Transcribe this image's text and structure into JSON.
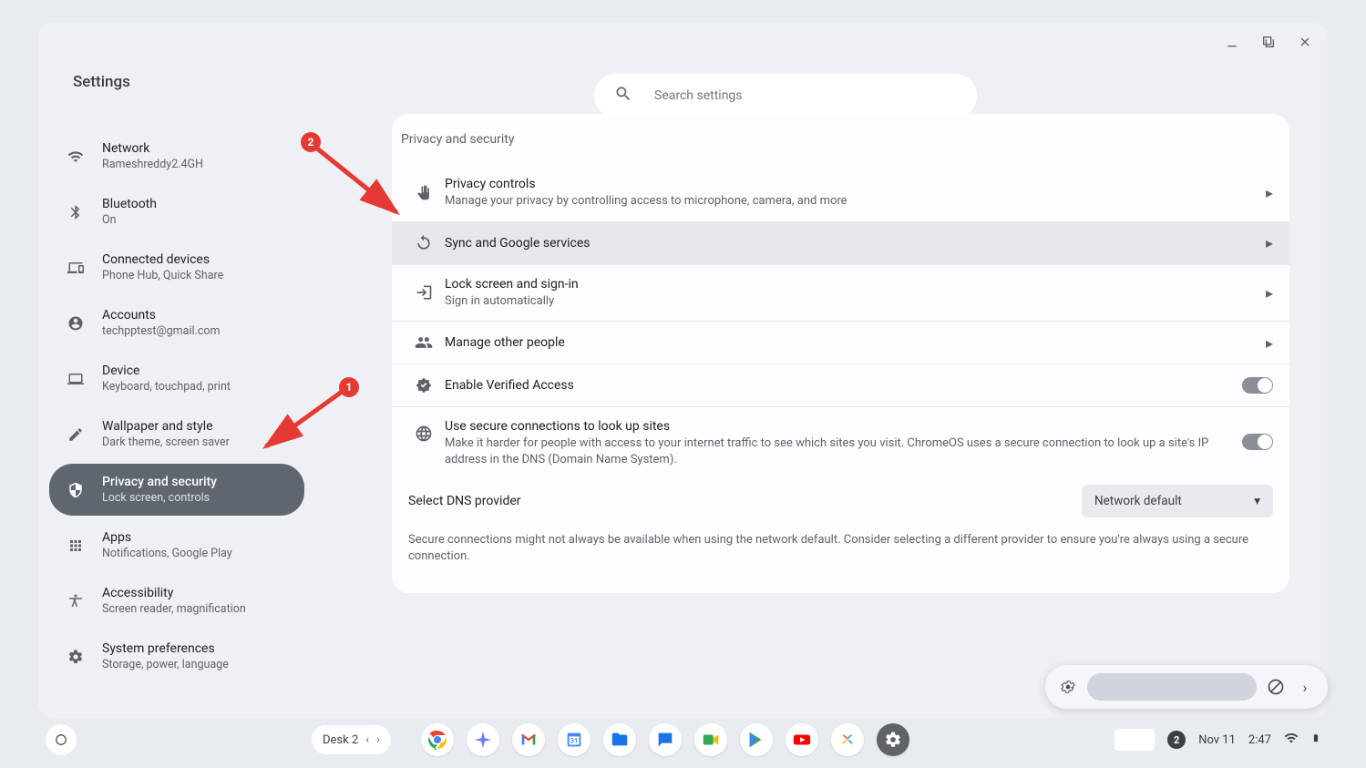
{
  "window": {
    "title": "Settings",
    "search_placeholder": "Search settings"
  },
  "sidebar": {
    "items": [
      {
        "title": "Network",
        "sub": "Rameshreddy2.4GH"
      },
      {
        "title": "Bluetooth",
        "sub": "On"
      },
      {
        "title": "Connected devices",
        "sub": "Phone Hub, Quick Share"
      },
      {
        "title": "Accounts",
        "sub": "techpptest@gmail.com"
      },
      {
        "title": "Device",
        "sub": "Keyboard, touchpad, print"
      },
      {
        "title": "Wallpaper and style",
        "sub": "Dark theme, screen saver"
      },
      {
        "title": "Privacy and security",
        "sub": "Lock screen, controls"
      },
      {
        "title": "Apps",
        "sub": "Notifications, Google Play"
      },
      {
        "title": "Accessibility",
        "sub": "Screen reader, magnification"
      },
      {
        "title": "System preferences",
        "sub": "Storage, power, language"
      }
    ]
  },
  "content": {
    "section_title": "Privacy and security",
    "rows": {
      "privacy_controls": {
        "title": "Privacy controls",
        "sub": "Manage your privacy by controlling access to microphone, camera, and more"
      },
      "sync": {
        "title": "Sync and Google services"
      },
      "lock": {
        "title": "Lock screen and sign-in",
        "sub": "Sign in automatically"
      },
      "people": {
        "title": "Manage other people"
      },
      "verified": {
        "title": "Enable Verified Access"
      },
      "secure_dns": {
        "title": "Use secure connections to look up sites",
        "sub": "Make it harder for people with access to your internet traffic to see which sites you visit. ChromeOS uses a secure connection to look up a site's IP address in the DNS (Domain Name System)."
      }
    },
    "dns_label": "Select DNS provider",
    "dns_value": "Network default",
    "dns_note": "Secure connections might not always be available when using the network default. Consider selecting a different provider to ensure you're always using a secure connection."
  },
  "annotations": {
    "b1": "1",
    "b2": "2"
  },
  "shelf": {
    "desk_label": "Desk 2",
    "badge_count": "2",
    "date": "Nov 11",
    "time": "2:47"
  }
}
